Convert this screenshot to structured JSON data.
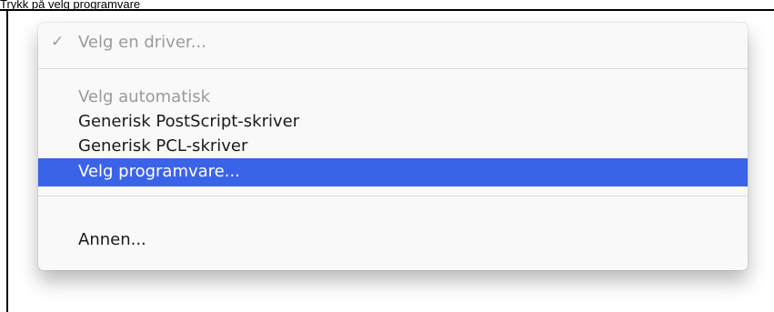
{
  "caption": "Trykk på velg programvare",
  "menu": {
    "check_glyph": "✓",
    "items": [
      {
        "label": "Velg en driver...",
        "state": "checked-disabled"
      },
      {
        "label": "Velg automatisk",
        "state": "disabled"
      },
      {
        "label": "Generisk PostScript-skriver",
        "state": "enabled"
      },
      {
        "label": "Generisk PCL-skriver",
        "state": "enabled"
      },
      {
        "label": "Velg programvare...",
        "state": "highlighted"
      },
      {
        "label": "Annen...",
        "state": "enabled"
      }
    ]
  },
  "colors": {
    "highlight": "#3b63e8",
    "disabled_text": "#9a9a9a",
    "menu_background": "#f9f9f9"
  }
}
